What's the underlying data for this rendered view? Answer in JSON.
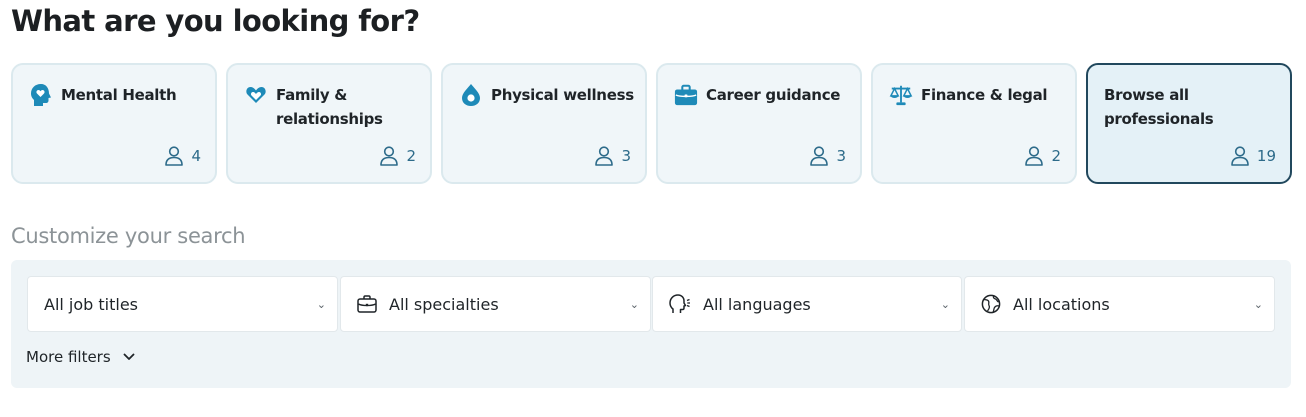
{
  "heading": "What are you looking for?",
  "categories": [
    {
      "title": "Mental Health",
      "count": "4",
      "icon": "head-heart-icon"
    },
    {
      "title": "Family & relationships",
      "count": "2",
      "icon": "heart-hands-icon"
    },
    {
      "title": "Physical wellness",
      "count": "3",
      "icon": "drop-icon"
    },
    {
      "title": "Career guidance",
      "count": "3",
      "icon": "briefcase-icon"
    },
    {
      "title": "Finance & legal",
      "count": "2",
      "icon": "scales-icon"
    },
    {
      "title": "Browse all professionals",
      "count": "19",
      "selected": true
    }
  ],
  "customize": {
    "title": "Customize your search",
    "filters": [
      {
        "label": "All job titles"
      },
      {
        "label": "All specialties",
        "icon": "briefcase-outline-icon"
      },
      {
        "label": "All languages",
        "icon": "speaking-head-icon"
      },
      {
        "label": "All locations",
        "icon": "globe-icon"
      }
    ],
    "more_filters": "More filters",
    "chevron": "⌄"
  },
  "colors": {
    "accent": "#1e8ab8",
    "selected_border": "#21485d",
    "card_bg": "#f0f6f9",
    "panel_bg": "#eef4f7",
    "count_text": "#2d6b8a"
  }
}
